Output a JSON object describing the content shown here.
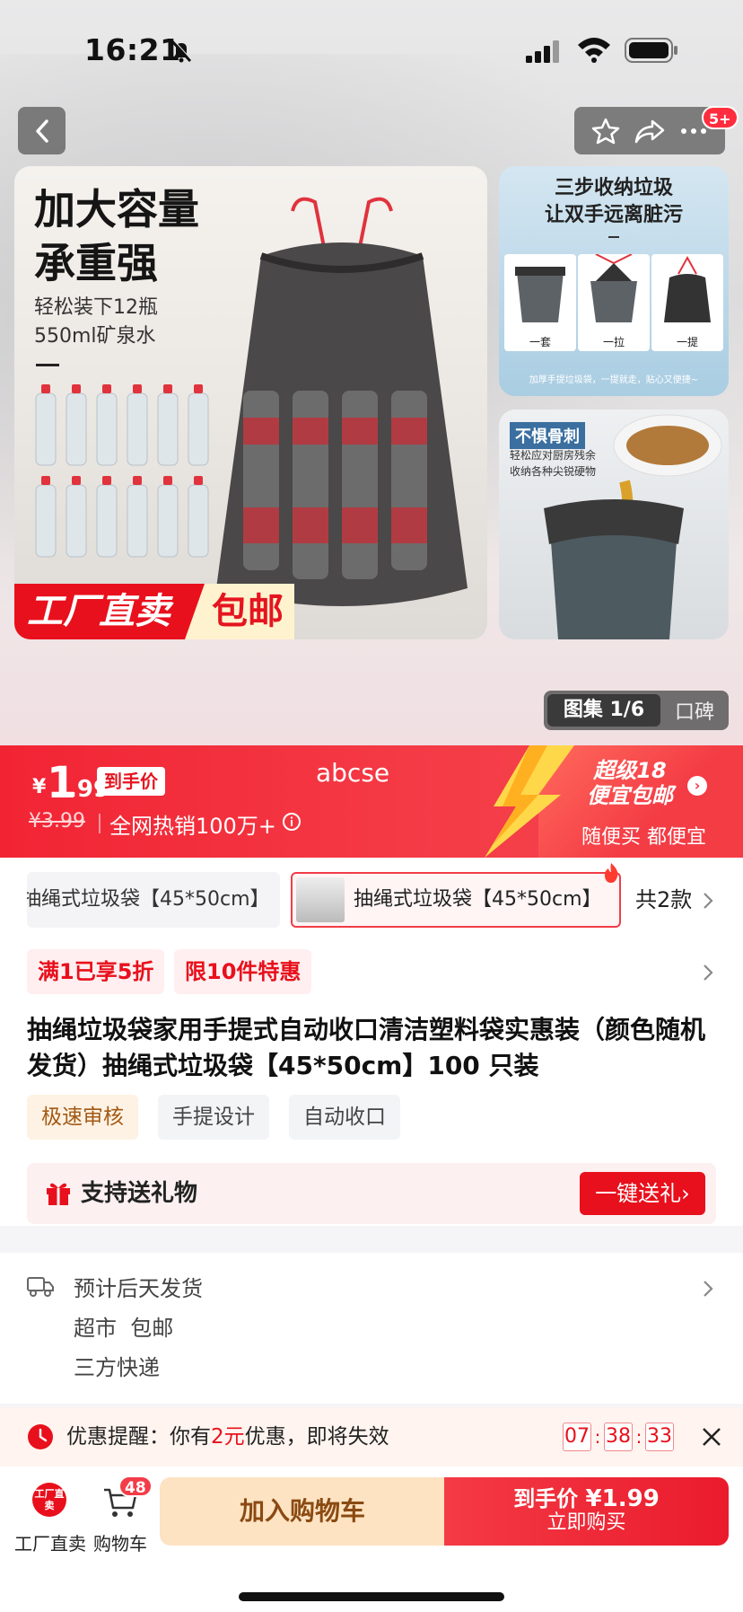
{
  "status_bar": {
    "time": "16:21"
  },
  "nav": {
    "badge": "5+"
  },
  "hero": {
    "headline": [
      "加大容量",
      "承重强"
    ],
    "sub": [
      "轻松装下12瓶",
      "550ml矿泉水"
    ],
    "promo_left": "工厂直卖",
    "promo_right": "包邮",
    "side1_title": [
      "三步收纳垃圾",
      "让双手远离脏污"
    ],
    "side1_steps": [
      "一套",
      "一拉",
      "一提"
    ],
    "side1_footer": "加厚手提垃圾袋，一提就走，贴心又便捷~",
    "side2_tag": "不惧骨刺",
    "side2_text": [
      "轻松应对厨房残余",
      "收纳各种尖锐硬物"
    ],
    "gallery_active": "图集 1/6",
    "gallery_other": "口碑"
  },
  "price": {
    "currency": "¥",
    "integer": "1",
    "decimal": ".99",
    "tag": "到手价",
    "original": "¥3.99",
    "sales": "全网热销100万+",
    "watermark": "abcse",
    "free_shipping": [
      "超级18",
      "便宜包邮"
    ],
    "free_sub": "随便买 都便宜"
  },
  "variants": {
    "first": "抽绳式垃圾袋【45*50cm】",
    "second": "抽绳式垃圾袋【45*50cm】",
    "count": "共2款"
  },
  "promos": [
    "满1已享5折",
    "限10件特惠"
  ],
  "product_title": "抽绳垃圾袋家用手提式自动收口清洁塑料袋实惠装（颜色随机发货）抽绳式垃圾袋【45*50cm】100 只装",
  "features": [
    "极速审核",
    "手提设计",
    "自动收口"
  ],
  "gift": {
    "text": "支持送礼物",
    "button": "一键送礼›"
  },
  "shipping": {
    "lines": [
      "预计后天发货",
      "超市  包邮",
      "三方快递"
    ]
  },
  "reminder": {
    "prefix": "优惠提醒：你有",
    "amount": "2元",
    "suffix": "优惠，即将失效",
    "timer": [
      "07",
      "38",
      "33"
    ]
  },
  "bottom": {
    "factory_logo": "工厂直卖",
    "factory_label": "工厂直卖",
    "cart_label": "购物车",
    "cart_badge": "48",
    "add_cart": "加入购物车",
    "buy_price_label": "到手价",
    "buy_price": "¥1.99",
    "buy_sub": "立即购买"
  },
  "colors": {
    "brand_red": "#e8101c",
    "price_band": "#f22434",
    "cart_btn": "#fde3c2"
  }
}
